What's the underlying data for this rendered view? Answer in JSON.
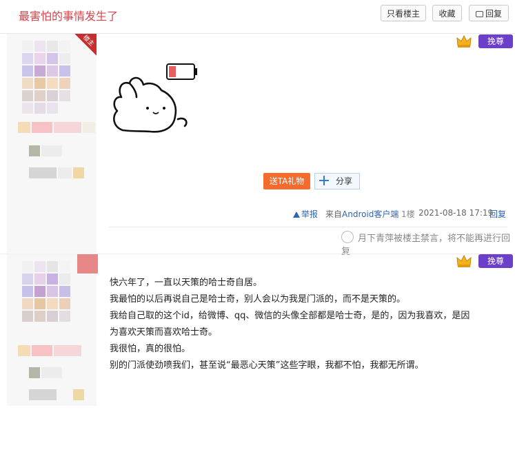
{
  "header": {
    "title": "最害怕的事情发生了",
    "btn_author_only": "只看楼主",
    "btn_favorite": "收藏",
    "btn_reply": "回复"
  },
  "post1": {
    "author_badge": "楼主",
    "zun_label": "挽尊",
    "gift_label": "送TA礼物",
    "share_label": "分享",
    "report_label": "举报",
    "source_prefix": "来自",
    "source_platform": "Android客户端",
    "floor": "1楼",
    "time": "2021-08-18 17:19",
    "reply_label": "回复",
    "notice": "月下青萍被楼主禁言，将不能再进行回复"
  },
  "post2": {
    "zun_label": "挽尊",
    "lines": [
      "快六年了，一直以天策的哈士奇自居。",
      "我最怕的以后再说自己是哈士奇，别人会以为我是门派的，而不是天策的。",
      "我给自己取的这个id，给微博、qq、微信的头像全部都是哈士奇，是的，因为我喜欢，是因",
      "为喜欢天策而喜欢哈士奇。",
      "我很怕，真的很怕。",
      "别的门派使劲喷我们，甚至说“最恶心天策”这些字眼，我都不怕，我都无所谓。"
    ]
  },
  "colors": {
    "title": "#d9434a",
    "gift": "#f36c2e",
    "link": "#2d64b3",
    "zun": "#6b3fc7"
  }
}
